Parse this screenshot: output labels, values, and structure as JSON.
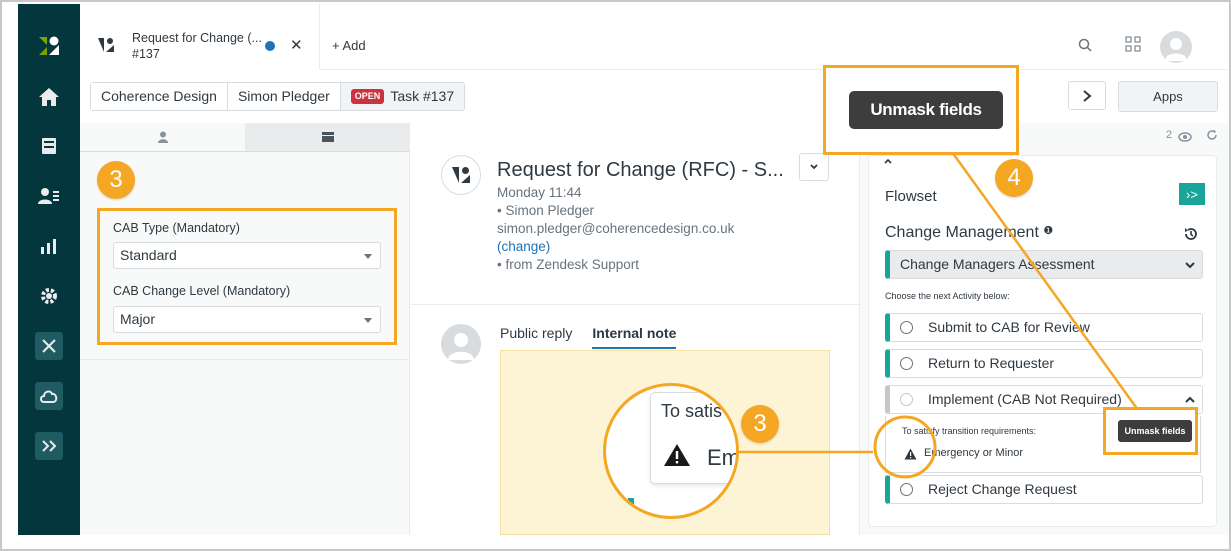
{
  "tab": {
    "title": "Request for Change (...",
    "subtitle": "#137",
    "add_label": "Add"
  },
  "breadcrumbs": {
    "org": "Coherence Design",
    "user": "Simon Pledger",
    "status": "OPEN",
    "task": "Task #137"
  },
  "toolbar": {
    "apps_label": "Apps"
  },
  "left_panel": {
    "step_number": "3",
    "cab_type_label": "CAB Type (Mandatory)",
    "cab_type_value": "Standard",
    "cab_level_label": "CAB Change Level (Mandatory)",
    "cab_level_value": "Major"
  },
  "ticket": {
    "title": "Request for Change (RFC) - S...",
    "time": "Monday 11:44",
    "requester": "• Simon Pledger",
    "email": "simon.pledger@coherencedesign.co.uk",
    "change_link": "(change)",
    "source": "• from Zendesk Support"
  },
  "reply": {
    "public_tab": "Public reply",
    "internal_tab": "Internal note"
  },
  "zoom": {
    "step_number": "3",
    "line1": "To satis",
    "line2": "Em"
  },
  "right_panel": {
    "view_count": "2",
    "flowset_label": "Flowset",
    "change_mgmt_label": "Change Management",
    "stage": "Change Managers Assessment",
    "choose_text": "Choose the next Activity below:",
    "activities": [
      "Submit to CAB for Review",
      "Return to Requester",
      "Implement (CAB Not Required)",
      "Reject Change Request"
    ],
    "requirement_title": "To satisfy transition requirements:",
    "requirement_item": "Emergency or Minor",
    "unmask_small": "Unmask fields",
    "step_number": "4"
  },
  "unmask_big": "Unmask fields",
  "colors": {
    "accent": "#f5a623",
    "nav": "#03363d",
    "teal": "#1aa59a",
    "link": "#1f73b7"
  }
}
